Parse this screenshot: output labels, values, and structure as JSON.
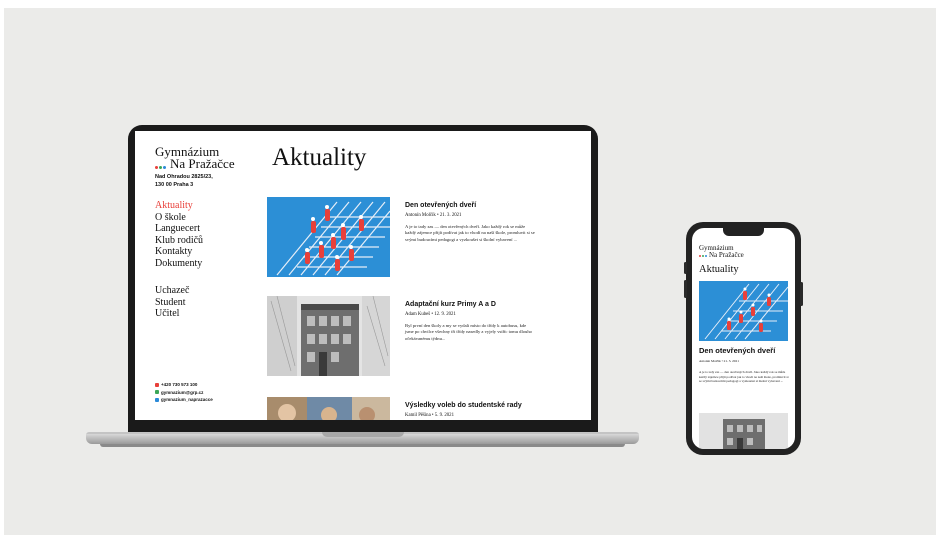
{
  "brand": {
    "name_line1": "Gymnázium",
    "name_line2": "Na Pražačce",
    "address_line1": "Nad Ohradou 2825/23,",
    "address_line2": "130 00 Praha 3",
    "dot_colors": [
      "#e8403a",
      "#3ba657",
      "#2b8ad8"
    ]
  },
  "nav": {
    "primary": [
      "Aktuality",
      "O škole",
      "Languecert",
      "Klub rodičů",
      "Kontakty",
      "Dokumenty"
    ],
    "secondary": [
      "Uchazeč",
      "Student",
      "Učitel"
    ],
    "active_index": 0
  },
  "contacts": [
    {
      "text": "+420 730 573 100",
      "color": "#e8403a"
    },
    {
      "text": "gymnazium@grp.cz",
      "color": "#3ba657"
    },
    {
      "text": "gymnazium_naprazacce",
      "color": "#2b8ad8"
    }
  ],
  "page_title": "Aktuality",
  "articles": [
    {
      "title": "Den otevřených dveří",
      "meta": "Antonín Molčík • 21. 3. 2021",
      "body": "A je to tady zas — den otevřených dveří. Jako každý rok se může každý zájemce přijít podívat jak to vhodí na naší škole, promluvit si se svými budoucími pedagogi a vyzkoušet si školní vybavení ..."
    },
    {
      "title": "Adaptační kurz Primy A a D",
      "meta": "Adam Kubeš • 12. 9. 2021",
      "body": "Byl první den školy a my se vydali místo do třídy k autobusu, kde jsme po chvilce všechny tři třídy nasedly a vyjely vstříc tomu dlouho očekávanému týdnu..."
    },
    {
      "title": "Výsledky voleb do studentské rady",
      "meta": "Kamil Pěšina • 5. 9. 2021",
      "body": ""
    }
  ],
  "colors": {
    "accent": "#e8403a",
    "thumb_blue": "#2c8fd6"
  }
}
